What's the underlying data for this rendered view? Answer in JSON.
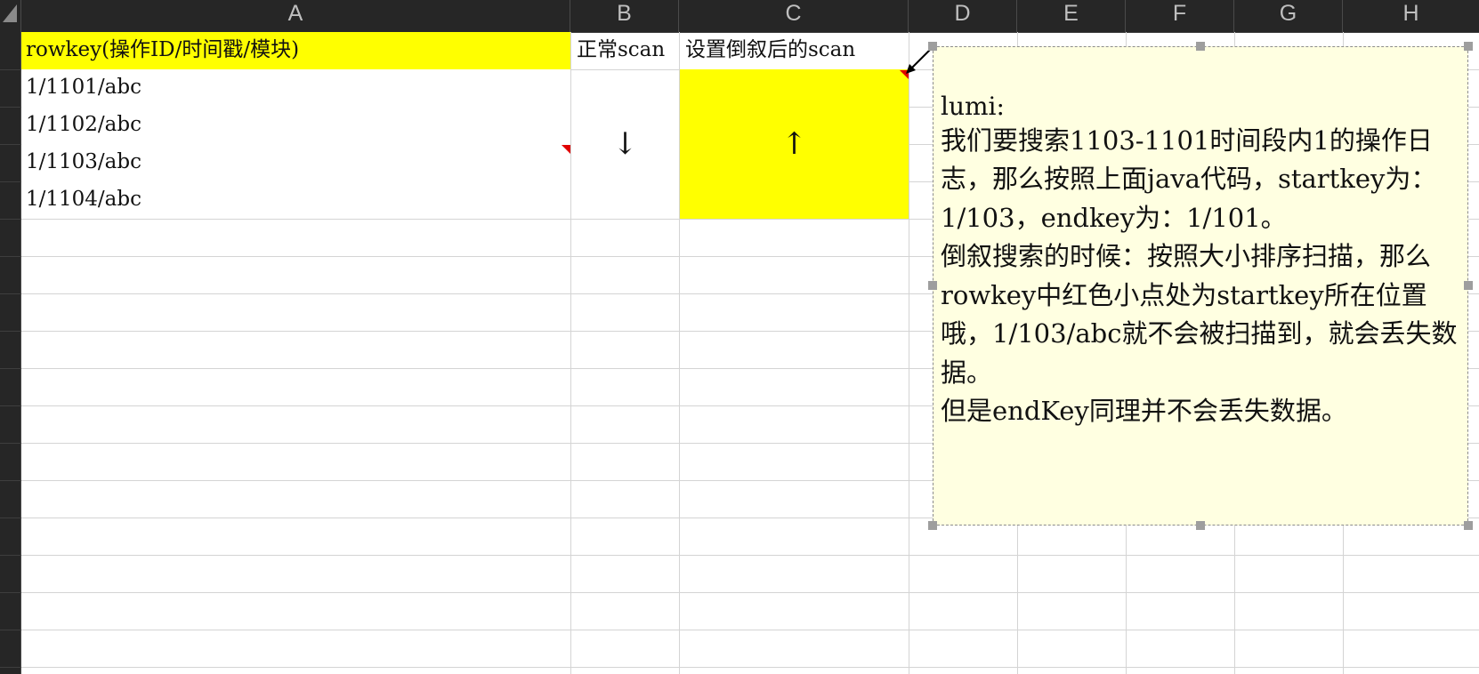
{
  "columns": [
    "A",
    "B",
    "C",
    "D",
    "E",
    "F",
    "G",
    "H"
  ],
  "cells": {
    "A1": "rowkey(操作ID/时间戳/模块)",
    "B1": "正常scan",
    "C1": "设置倒叙后的scan",
    "A2": "1/1101/abc",
    "A3": "1/1102/abc",
    "A4": "1/1103/abc",
    "A5": "1/1104/abc",
    "B_merged": "↓",
    "C_merged": "↑"
  },
  "comment": {
    "author": "lumi:",
    "text": "我们要搜索1103-1101时间段内1的操作日志，那么按照上面java代码，startkey为：1/103，endkey为：1/101。\n倒叙搜索的时候：按照大小排序扫描，那么rowkey中红色小点处为startkey所在位置哦，1/103/abc就不会被扫描到，就会丢失数据。\n但是endKey同理并不会丢失数据。"
  },
  "colors": {
    "highlight": "#ffff00",
    "comment_bg": "#ffffe1",
    "header_bg": "#262626",
    "indicator": "#e00000"
  }
}
